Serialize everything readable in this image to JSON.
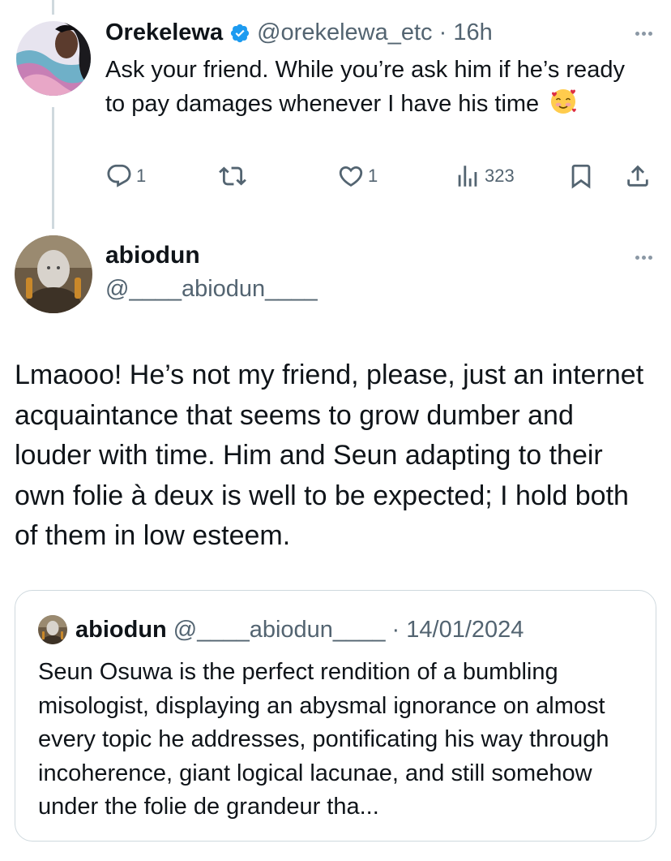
{
  "reply": {
    "display_name": "Orekelewa",
    "handle": "@orekelewa_etc",
    "separator": "·",
    "time": "16h",
    "text": "Ask your friend. While you’re ask him if he’s ready to pay damages whenever I have his time",
    "emoji": "smiling-face-with-hearts",
    "actions": {
      "replies": "1",
      "retweets": "",
      "likes": "1",
      "views": "323"
    }
  },
  "tweet": {
    "display_name": "abiodun",
    "handle": "@____abiodun____",
    "text": "Lmaooo! He’s not my friend, please, just an internet acquaintance that seems to grow dumber and louder with time. Him and Seun adapting to their own folie à deux is well to be expected; I hold both of them in low esteem."
  },
  "quote": {
    "display_name": "abiodun",
    "handle": "@____abiodun____",
    "separator": "·",
    "date": "14/01/2024",
    "text": "Seun Osuwa is the perfect rendition of a bumbling misologist, displaying an abysmal ignorance on almost every topic he addresses, pontificating his way through incoherence, giant logical lacunae, and still somehow under the folie de grandeur tha..."
  },
  "colors": {
    "text": "#0f1419",
    "secondary": "#536471",
    "verified": "#1d9bf0",
    "border": "#cfd9de"
  }
}
